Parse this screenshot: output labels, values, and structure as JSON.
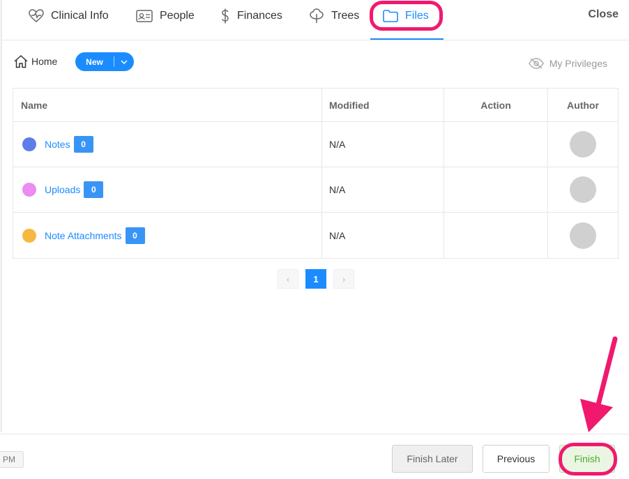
{
  "tabs": [
    {
      "label": "Clinical Info",
      "icon": "heart-pulse-icon"
    },
    {
      "label": "People",
      "icon": "id-card-icon"
    },
    {
      "label": "Finances",
      "icon": "dollar-icon"
    },
    {
      "label": "Trees",
      "icon": "tree-icon"
    },
    {
      "label": "Files",
      "icon": "folder-icon",
      "active": true
    }
  ],
  "close_label": "Close",
  "toolbar": {
    "home_label": "Home",
    "new_label": "New",
    "privileges_label": "My Privileges"
  },
  "table": {
    "headers": [
      "Name",
      "Modified",
      "Action",
      "Author"
    ],
    "rows": [
      {
        "name": "Notes",
        "count": "0",
        "modified": "N/A",
        "dot_color": "#5f7dea"
      },
      {
        "name": "Uploads",
        "count": "0",
        "modified": "N/A",
        "dot_color": "#ec8bf1"
      },
      {
        "name": "Note Attachments",
        "count": "0",
        "modified": "N/A",
        "dot_color": "#f5b942"
      }
    ]
  },
  "pagination": {
    "prev": "‹",
    "current": "1",
    "next": "›"
  },
  "footer": {
    "time_suffix": "PM",
    "finish_later_label": "Finish Later",
    "previous_label": "Previous",
    "finish_label": "Finish"
  },
  "colors": {
    "accent": "#1a8cff",
    "highlight": "#f0196e",
    "finish_green": "#4caa2b"
  }
}
